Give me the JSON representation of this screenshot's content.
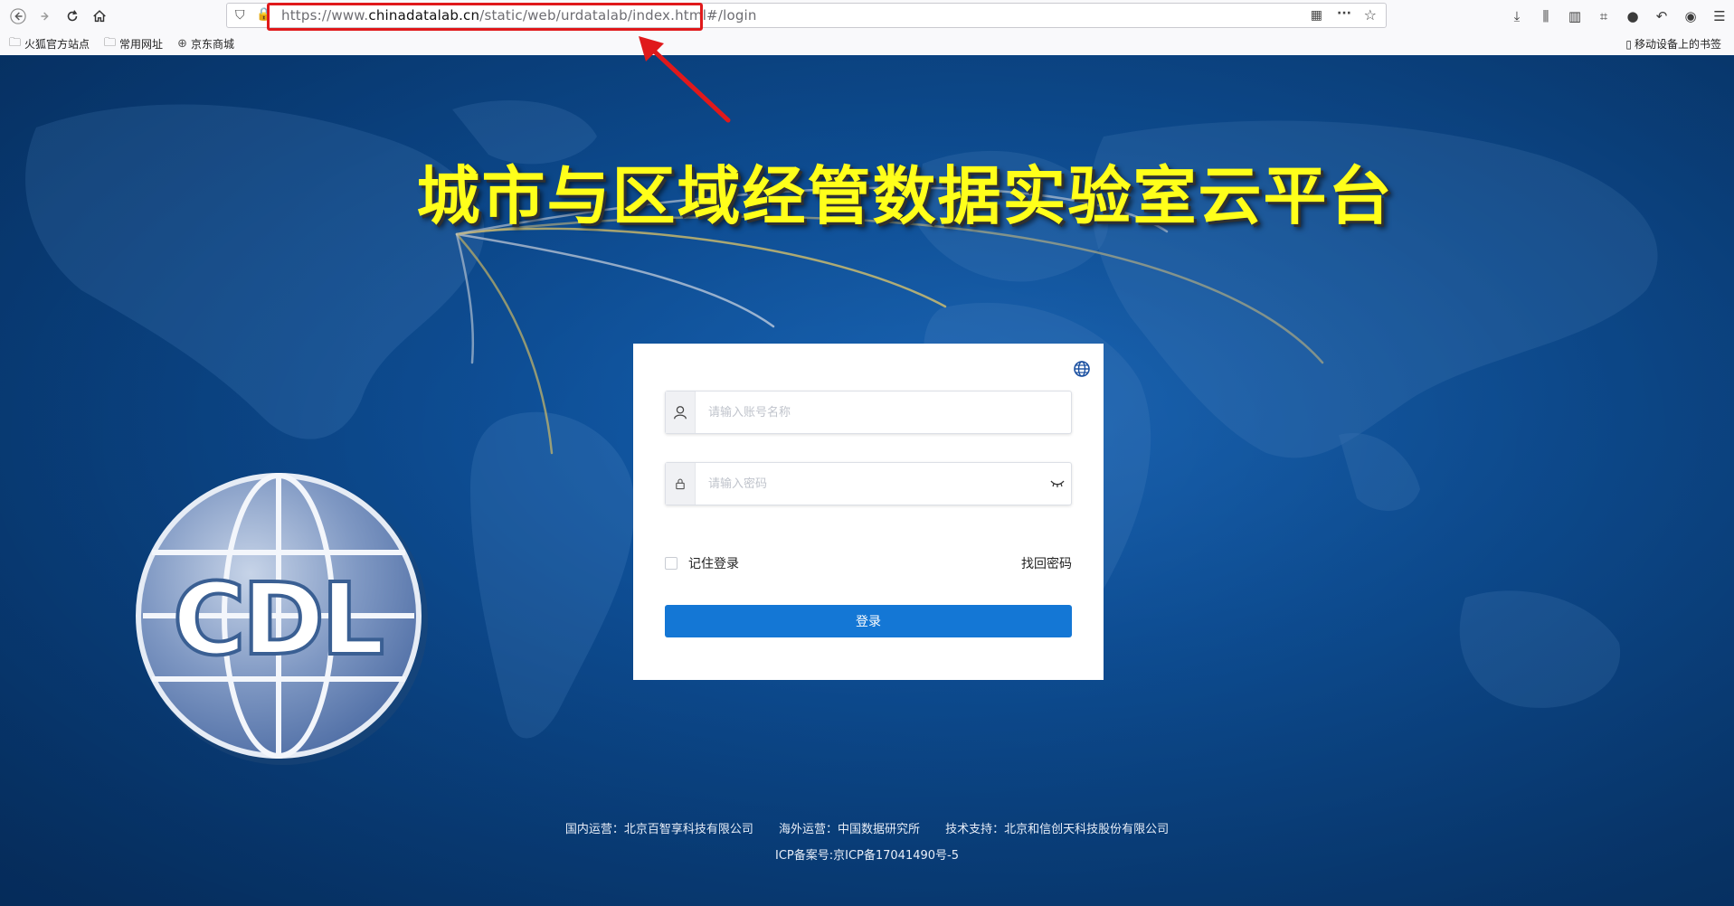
{
  "browser": {
    "url_prefix": "https://www.",
    "url_domain": "chinadatalab.cn",
    "url_path": "/static/web/urdatalab/index.html#/login",
    "bookmarks": [
      {
        "label": "火狐官方站点",
        "icon": "folder-icon"
      },
      {
        "label": "常用网址",
        "icon": "folder-icon"
      },
      {
        "label": "京东商城",
        "icon": "globe-icon"
      }
    ],
    "mobile_bookmarks": "移动设备上的书签"
  },
  "page": {
    "title": "城市与区域经管数据实验室云平台",
    "logo_text": "CDL"
  },
  "login": {
    "username_placeholder": "请输入账号名称",
    "password_placeholder": "请输入密码",
    "remember_label": "记住登录",
    "forgot_label": "找回密码",
    "login_button": "登录"
  },
  "footer": {
    "domestic": "国内运营：北京百智享科技有限公司",
    "overseas": "海外运营：中国数据研究所",
    "support": "技术支持：北京和信创天科技股份有限公司",
    "icp": "ICP备案号:京ICP备17041490号-5"
  },
  "colors": {
    "title": "#ffff1a",
    "button": "#1477d5",
    "highlight": "#e0191b"
  }
}
